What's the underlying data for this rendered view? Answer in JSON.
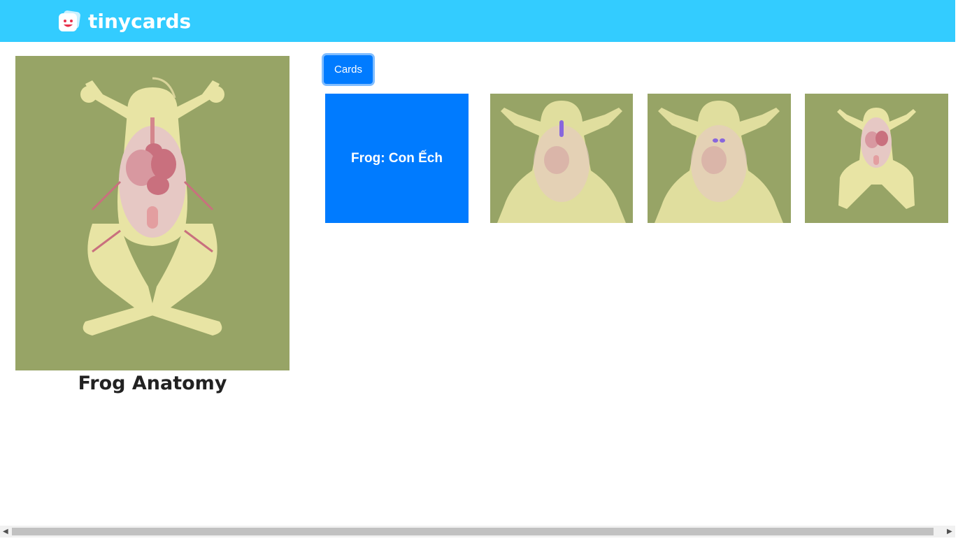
{
  "header": {
    "logo_text": "tinycards",
    "logo_icon": "tinycards-face-icon",
    "background": "#33ccff"
  },
  "deck": {
    "title": "Frog Anatomy",
    "image": "frog-anatomy-illustration"
  },
  "tabs": {
    "cards_label": "Cards"
  },
  "cards": [
    {
      "front_text": "Frog: Con Ếch",
      "color": "#007bff"
    },
    {
      "image": "frog-esophagus-highlight"
    },
    {
      "image": "frog-lungs-highlight"
    },
    {
      "image": "frog-organs-overview"
    }
  ],
  "colors": {
    "accent": "#007bff",
    "card_background": "#97a466"
  }
}
